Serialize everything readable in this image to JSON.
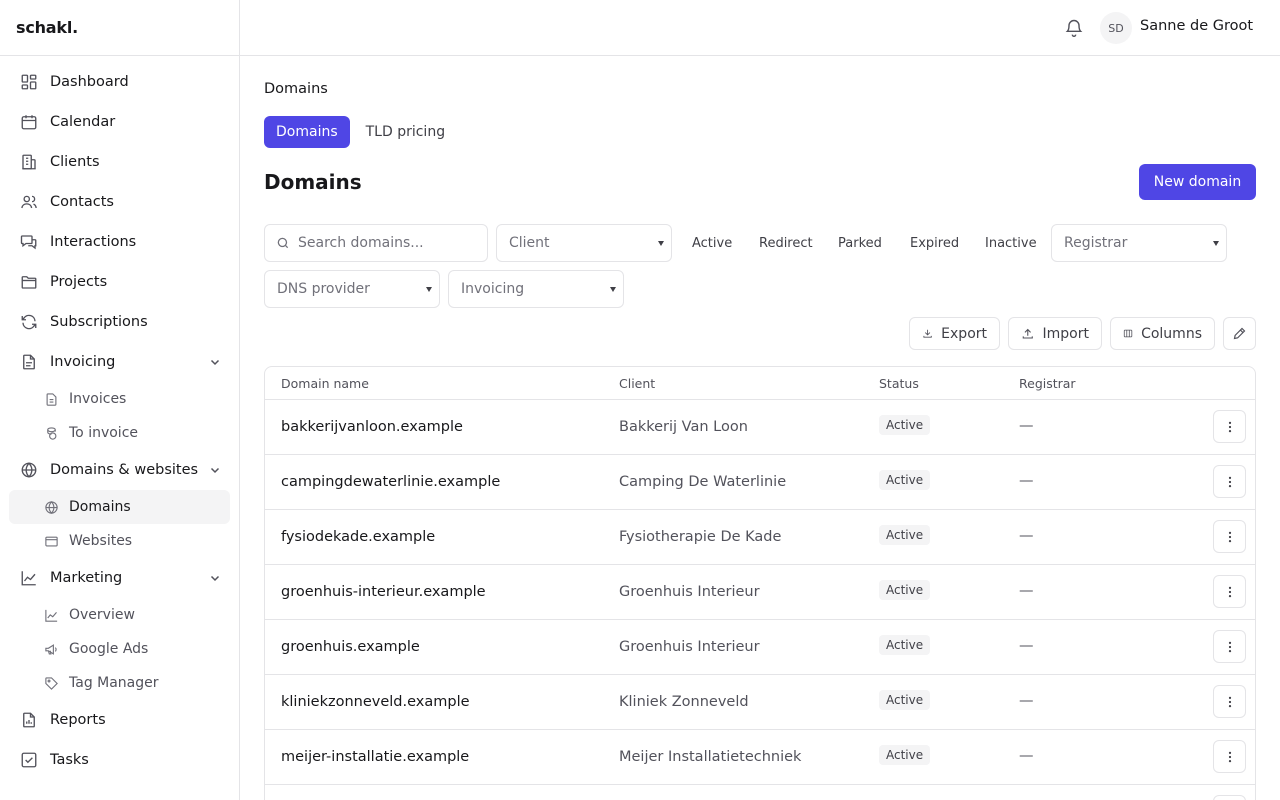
{
  "app": {
    "logo": "schakl."
  },
  "header": {
    "user_initials": "SD",
    "user_name": "Sanne de Groot"
  },
  "sidebar": {
    "items": [
      {
        "label": "Dashboard",
        "icon": "dashboard-icon"
      },
      {
        "label": "Calendar",
        "icon": "calendar-icon"
      },
      {
        "label": "Clients",
        "icon": "building-icon"
      },
      {
        "label": "Contacts",
        "icon": "users-icon"
      },
      {
        "label": "Interactions",
        "icon": "chat-icon"
      },
      {
        "label": "Projects",
        "icon": "folder-icon"
      },
      {
        "label": "Subscriptions",
        "icon": "refresh-icon"
      },
      {
        "label": "Invoicing",
        "icon": "document-icon",
        "expanded": true,
        "children": [
          {
            "label": "Invoices",
            "icon": "file-icon"
          },
          {
            "label": "To invoice",
            "icon": "coins-icon"
          }
        ]
      },
      {
        "label": "Domains & websites",
        "icon": "globe-icon",
        "expanded": true,
        "children": [
          {
            "label": "Domains",
            "icon": "globe-icon",
            "active": true
          },
          {
            "label": "Websites",
            "icon": "browser-icon"
          }
        ]
      },
      {
        "label": "Marketing",
        "icon": "chart-icon",
        "expanded": true,
        "children": [
          {
            "label": "Overview",
            "icon": "chart-icon"
          },
          {
            "label": "Google Ads",
            "icon": "megaphone-icon"
          },
          {
            "label": "Tag Manager",
            "icon": "tag-icon"
          }
        ]
      },
      {
        "label": "Reports",
        "icon": "report-icon"
      },
      {
        "label": "Tasks",
        "icon": "checkbox-icon"
      }
    ]
  },
  "main": {
    "breadcrumb": "Domains",
    "tabs": [
      {
        "label": "Domains",
        "active": true
      },
      {
        "label": "TLD pricing",
        "active": false
      }
    ],
    "title": "Domains",
    "new_button": "New domain",
    "filters": {
      "search_placeholder": "Search domains...",
      "client": "Client",
      "status_chips": [
        "Active",
        "Redirect",
        "Parked",
        "Expired",
        "Inactive"
      ],
      "registrar": "Registrar",
      "dns_provider": "DNS provider",
      "invoicing": "Invoicing"
    },
    "toolbar": {
      "export": "Export",
      "import": "Import",
      "columns": "Columns"
    },
    "table": {
      "columns": [
        "Domain name",
        "Client",
        "Status",
        "Registrar"
      ],
      "rows": [
        {
          "domain": "bakkerijvanloon.example",
          "client": "Bakkerij Van Loon",
          "status": "Active",
          "registrar": "—"
        },
        {
          "domain": "campingdewaterlinie.example",
          "client": "Camping De Waterlinie",
          "status": "Active",
          "registrar": "—"
        },
        {
          "domain": "fysiodekade.example",
          "client": "Fysiotherapie De Kade",
          "status": "Active",
          "registrar": "—"
        },
        {
          "domain": "groenhuis-interieur.example",
          "client": "Groenhuis Interieur",
          "status": "Active",
          "registrar": "—"
        },
        {
          "domain": "groenhuis.example",
          "client": "Groenhuis Interieur",
          "status": "Active",
          "registrar": "—"
        },
        {
          "domain": "kliniekzonneveld.example",
          "client": "Kliniek Zonneveld",
          "status": "Active",
          "registrar": "—"
        },
        {
          "domain": "meijer-installatie.example",
          "client": "Meijer Installatietechniek",
          "status": "Active",
          "registrar": "—"
        }
      ]
    }
  },
  "colors": {
    "accent": "#4f46e5",
    "border": "#e4e4e7",
    "muted": "#71717a",
    "badge_bg": "#f4f4f5"
  }
}
